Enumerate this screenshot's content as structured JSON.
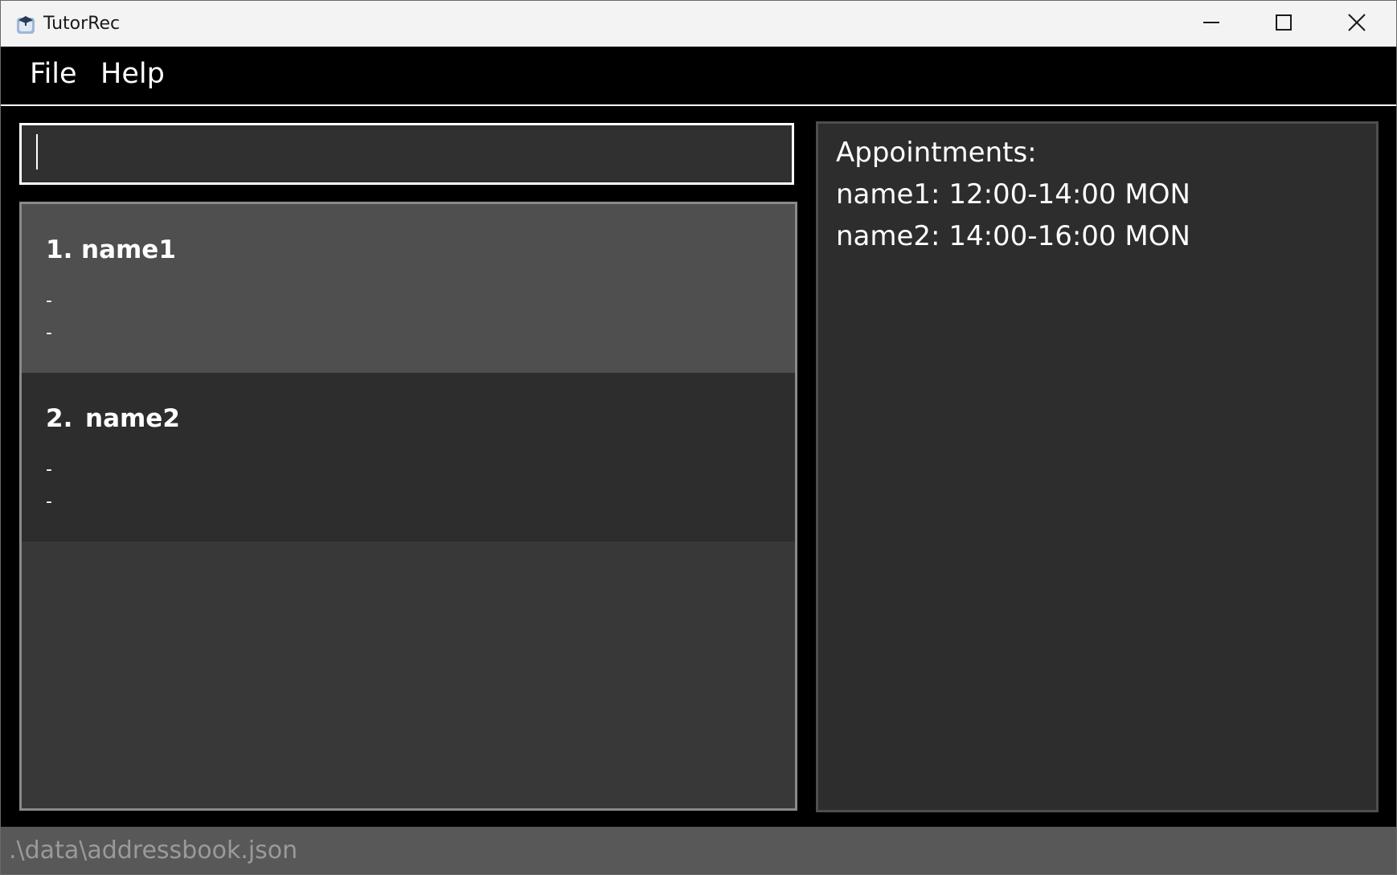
{
  "window": {
    "title": "TutorRec",
    "icon": "app-logo-icon",
    "controls": [
      "minimize-icon",
      "maximize-icon",
      "close-icon"
    ]
  },
  "menu": {
    "items": [
      {
        "label": "File"
      },
      {
        "label": "Help"
      }
    ]
  },
  "command_box": {
    "value": ""
  },
  "person_list": {
    "items": [
      {
        "index": "1.",
        "name": "name1",
        "fields": [
          "-",
          "-"
        ],
        "selected": true
      },
      {
        "index": "2.",
        "name": "name2",
        "fields": [
          "-",
          "-"
        ],
        "selected": false
      }
    ]
  },
  "appointments": {
    "heading": "Appointments:",
    "entries": [
      "name1: 12:00-14:00 MON",
      "name2: 14:00-16:00 MON"
    ]
  },
  "status_bar": {
    "path": ".\\data\\addressbook.json"
  },
  "colors": {
    "background": "#000000",
    "panel": "#2d2d2d",
    "selected_card": "#4f4f4f",
    "status_bar": "#585858",
    "text": "#ffffff"
  }
}
